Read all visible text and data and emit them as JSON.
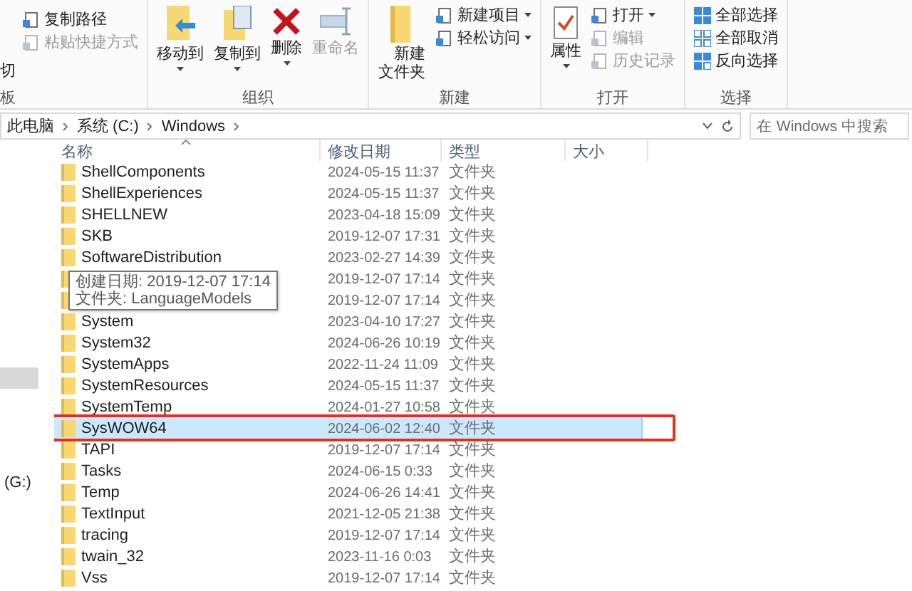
{
  "ribbon": {
    "clipboard_partial": {
      "items": [
        {
          "label": "复制路径",
          "disabled": false
        },
        {
          "label": "粘贴快捷方式",
          "disabled": true
        }
      ],
      "cut_command": "切",
      "group_label": "板"
    },
    "groups": [
      {
        "label": "组织",
        "items": [
          {
            "kind": "large",
            "label": "移动到",
            "disabled": false,
            "dropdown": true
          },
          {
            "kind": "large",
            "label": "复制到",
            "disabled": false,
            "dropdown": true
          },
          {
            "kind": "large",
            "label": "删除",
            "disabled": false,
            "dropdown": true
          },
          {
            "kind": "large",
            "label": "重命名",
            "disabled": true,
            "dropdown": false
          }
        ]
      },
      {
        "label": "新建",
        "items": [
          {
            "kind": "large",
            "label": "新建文件夹",
            "disabled": false,
            "dropdown": false
          },
          {
            "kind": "small",
            "label": "新建项目",
            "disabled": false,
            "dropdown": true
          },
          {
            "kind": "small",
            "label": "轻松访问",
            "disabled": false,
            "dropdown": true
          }
        ]
      },
      {
        "label": "打开",
        "items": [
          {
            "kind": "large",
            "label": "属性",
            "disabled": false,
            "dropdown": true
          },
          {
            "kind": "small",
            "label": "打开",
            "disabled": false,
            "dropdown": true
          },
          {
            "kind": "small",
            "label": "编辑",
            "disabled": true,
            "dropdown": false
          },
          {
            "kind": "small",
            "label": "历史记录",
            "disabled": true,
            "dropdown": false
          }
        ]
      },
      {
        "label": "选择",
        "items": [
          {
            "kind": "small",
            "label": "全部选择",
            "disabled": false,
            "dropdown": false
          },
          {
            "kind": "small",
            "label": "全部取消",
            "disabled": false,
            "dropdown": false
          },
          {
            "kind": "small",
            "label": "反向选择",
            "disabled": false,
            "dropdown": false
          }
        ]
      }
    ]
  },
  "address": {
    "breadcrumbs": [
      "此电脑",
      "系统 (C:)",
      "Windows"
    ]
  },
  "search": {
    "placeholder": "在 Windows 中搜索"
  },
  "nav": {
    "items": [
      {
        "selected": true
      },
      {
        "label": "(G:)",
        "selected": false
      }
    ]
  },
  "table": {
    "columns": [
      {
        "label": "名称",
        "sorted": true
      },
      {
        "label": "修改日期",
        "sorted": false
      },
      {
        "label": "类型",
        "sorted": false
      },
      {
        "label": "大小",
        "sorted": false
      }
    ],
    "rows": [
      {
        "name": "ShellComponents",
        "date": "2024-05-15 11:37",
        "type": "文件夹",
        "selected": false,
        "annotated": false
      },
      {
        "name": "ShellExperiences",
        "date": "2024-05-15 11:37",
        "type": "文件夹",
        "selected": false,
        "annotated": false
      },
      {
        "name": "SHELLNEW",
        "date": "2023-04-18 15:09",
        "type": "文件夹",
        "selected": false,
        "annotated": false
      },
      {
        "name": "SKB",
        "date": "2019-12-07 17:31",
        "type": "文件夹",
        "selected": false,
        "annotated": false
      },
      {
        "name": "SoftwareDistribution",
        "date": "2023-02-27 14:39",
        "type": "文件夹",
        "selected": false,
        "annotated": false
      },
      {
        "date": "2019-12-07 17:14",
        "type": "文件夹",
        "selected": false,
        "annotated": false
      },
      {
        "date": "2019-12-07 17:14",
        "type": "文件夹",
        "selected": false,
        "annotated": false
      },
      {
        "name": "System",
        "date": "2023-04-10 17:27",
        "type": "文件夹",
        "selected": false,
        "annotated": false
      },
      {
        "name": "System32",
        "date": "2024-06-26 10:19",
        "type": "文件夹",
        "selected": false,
        "annotated": false
      },
      {
        "name": "SystemApps",
        "date": "2022-11-24 11:09",
        "type": "文件夹",
        "selected": false,
        "annotated": false
      },
      {
        "name": "SystemResources",
        "date": "2024-05-15 11:37",
        "type": "文件夹",
        "selected": false,
        "annotated": false
      },
      {
        "name": "SystemTemp",
        "date": "2024-01-27 10:58",
        "type": "文件夹",
        "selected": false,
        "annotated": false
      },
      {
        "name": "SysWOW64",
        "date": "2024-06-02 12:40",
        "type": "文件夹",
        "selected": true,
        "annotated": true
      },
      {
        "name": "TAPI",
        "date": "2019-12-07 17:14",
        "type": "文件夹",
        "selected": false,
        "annotated": false
      },
      {
        "name": "Tasks",
        "date": "2024-06-15 0:33",
        "type": "文件夹",
        "selected": false,
        "annotated": false
      },
      {
        "name": "Temp",
        "date": "2024-06-26 14:41",
        "type": "文件夹",
        "selected": false,
        "annotated": false
      },
      {
        "name": "TextInput",
        "date": "2021-12-05 21:38",
        "type": "文件夹",
        "selected": false,
        "annotated": false
      },
      {
        "name": "tracing",
        "date": "2019-12-07 17:14",
        "type": "文件夹",
        "selected": false,
        "annotated": false
      },
      {
        "name": "twain_32",
        "date": "2023-11-16 0:03",
        "type": "文件夹",
        "selected": false,
        "annotated": false
      },
      {
        "name": "Vss",
        "date": "2019-12-07 17:14",
        "type": "文件夹",
        "selected": false,
        "annotated": false
      }
    ]
  },
  "tooltip": {
    "lines": [
      "创建日期: 2019-12-07 17:14",
      "文件夹: LanguageModels"
    ]
  }
}
